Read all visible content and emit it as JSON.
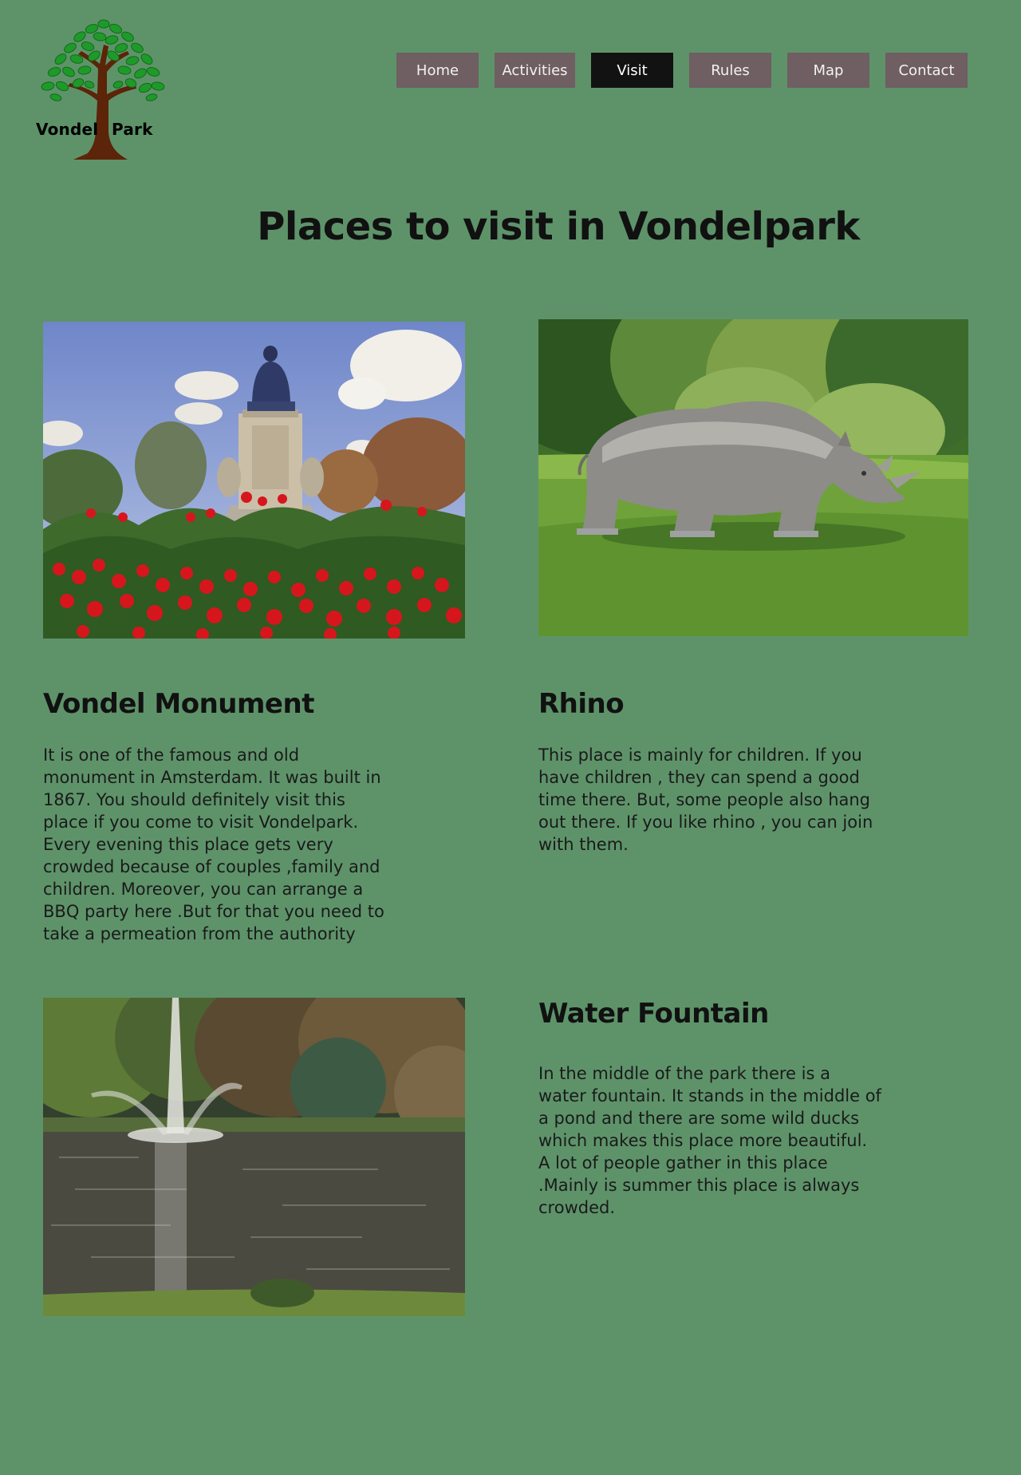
{
  "logo": {
    "word_left": "Vondel",
    "word_right": "Park",
    "icon": "tree-icon"
  },
  "nav": {
    "items": [
      {
        "label": "Home",
        "active": false
      },
      {
        "label": "Activities",
        "active": false
      },
      {
        "label": "Visit",
        "active": true
      },
      {
        "label": "Rules",
        "active": false
      },
      {
        "label": "Map",
        "active": false
      },
      {
        "label": "Contact",
        "active": false
      }
    ]
  },
  "page": {
    "title": "Places to visit in Vondelpark"
  },
  "sections": {
    "monument": {
      "heading": "Vondel Monument",
      "text": "It is one of the famous and old monument in Amsterdam. It was built in 1867. You should definitely visit this place if you come to visit Vondelpark. Every evening this place gets very crowded because of couples ,family and children. Moreover, you can arrange a BBQ party here .But for that you need to take a permeation from the authority"
    },
    "rhino": {
      "heading": "Rhino",
      "text": "This place is mainly for children. If you have children , they can spend a good time there. But, some people also hang out there. If you like rhino , you can join with them."
    },
    "fountain": {
      "heading": "Water Fountain",
      "text": "In the middle of the park there is  a water fountain. It stands in the middle of a pond and there are some wild ducks which makes this place more beautiful. A lot of people gather in this place .Mainly is summer this place is always crowded."
    }
  },
  "colors": {
    "background": "#5e936a",
    "nav_button": "#6f5e62",
    "nav_active": "#121212",
    "tree_leaves": "#1f9a2a",
    "tree_trunk": "#5c2408"
  }
}
